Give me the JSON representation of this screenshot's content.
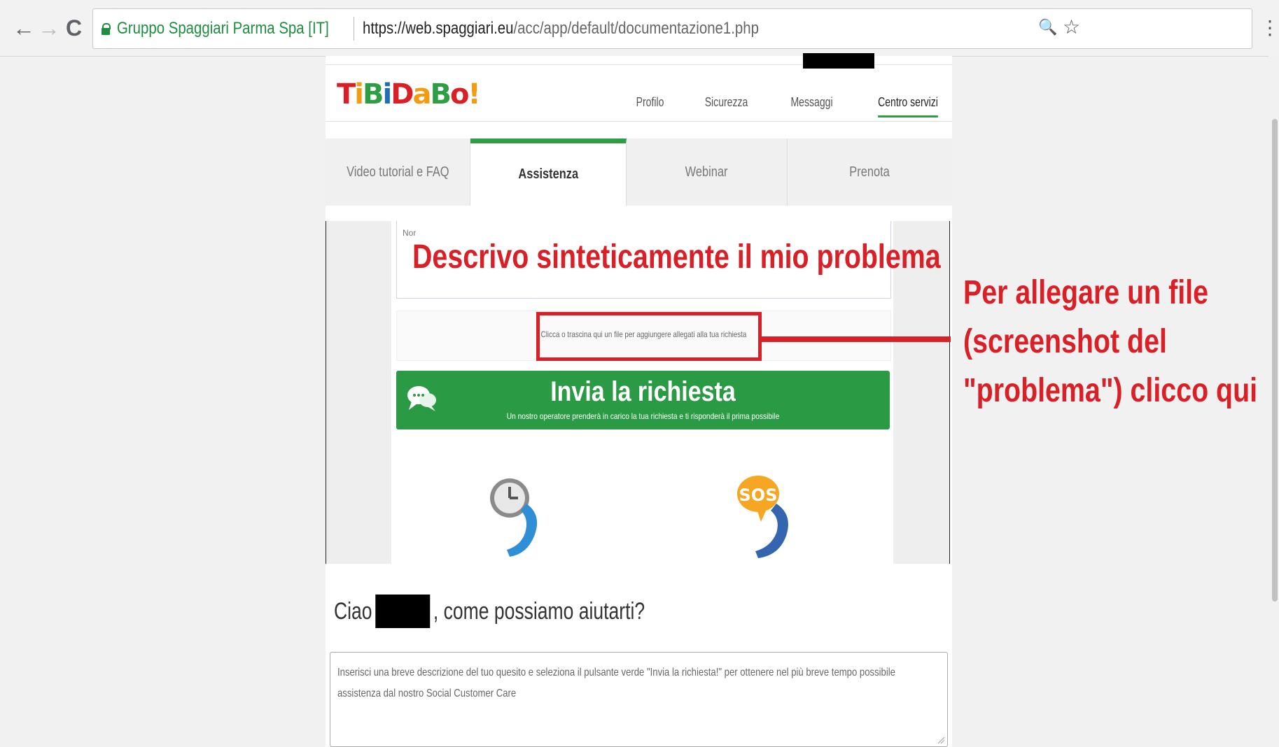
{
  "browser": {
    "site_name": "Gruppo Spaggiari Parma Spa [IT]",
    "url_domain": "https://web.spaggiari.eu",
    "url_path": "/acc/app/default/documentazione1.php",
    "back_icon": "←",
    "forward_icon": "→",
    "reload_icon": "C",
    "zoom_icon": "🔍",
    "star_icon": "☆",
    "menu_icon": "⋮"
  },
  "logo": {
    "letters": [
      "T",
      "i",
      "B",
      "i",
      "D",
      "a",
      "B",
      "o",
      "!"
    ],
    "colors": [
      "#d92027",
      "#f39c12",
      "#2e9e44",
      "#1f6fb8",
      "#d92027",
      "#f39c12",
      "#2e9e44",
      "#d92027",
      "#f39c12"
    ]
  },
  "topnav": [
    "Profilo",
    "Sicurezza",
    "Messaggi",
    "Centro servizi"
  ],
  "tabs": [
    "Video tutorial e FAQ",
    "Assistenza",
    "Webinar",
    "Prenota"
  ],
  "form": {
    "textarea_value": "Nor",
    "drop_zone_text": "Clicca o trascina qui un file per aggiungere allegati alla tua richiesta",
    "send_button_label": "Invia la richiesta",
    "send_button_sub": "Un nostro operatore prenderà in carico la tua richiesta e ti risponderà il prima possibile",
    "sos_label": "SOS"
  },
  "greeting": {
    "prefix": "Ciao",
    "suffix": ", come possiamo aiutarti?"
  },
  "question_box_text": "Inserisci una breve descrizione del tuo quesito e seleziona il pulsante verde \"Invia la richiesta!\" per ottenere nel più breve tempo possibile assistenza dal nostro Social Customer Care",
  "annotations": {
    "overlay_title": "Descrivo sinteticamente il mio problema",
    "callout_lines": [
      "Per allegare un file",
      "(screenshot del",
      "\"problema\") clicco qui"
    ]
  },
  "colors": {
    "accent_green": "#2e9e44",
    "annotation_red": "#d92027"
  }
}
